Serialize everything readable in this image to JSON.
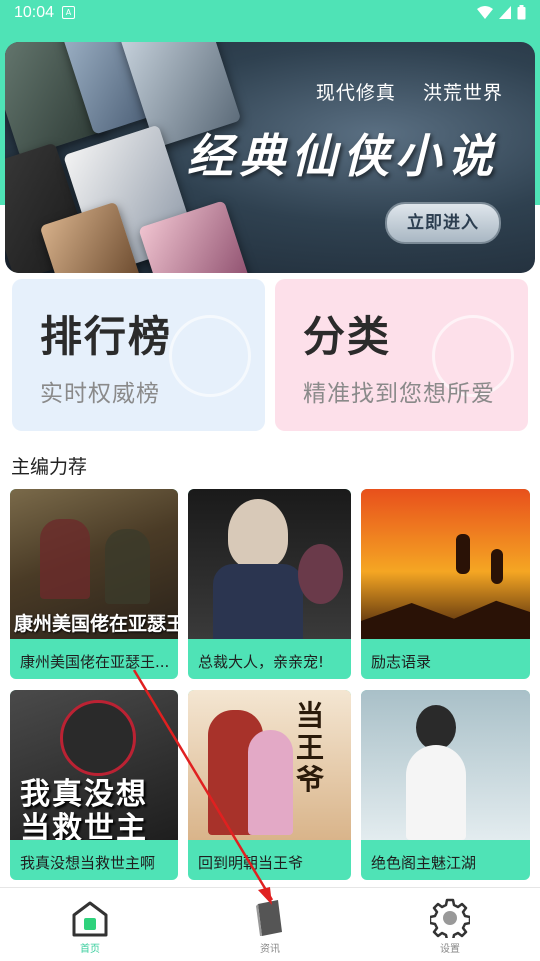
{
  "status_bar": {
    "time": "10:04"
  },
  "banner": {
    "tag_1": "现代修真",
    "tag_2": "洪荒世界",
    "title": "经典仙侠小说",
    "enter_button": "立即进入"
  },
  "entry_cards": [
    {
      "title": "排行榜",
      "subtitle": "实时权威榜"
    },
    {
      "title": "分类",
      "subtitle": "精准找到您想所爱"
    }
  ],
  "section_title": "主编力荐",
  "books": [
    {
      "title": "康州美国佬在亚瑟王...",
      "cover_text": "康州美国佬在亚瑟王朝"
    },
    {
      "title": "总裁大人，亲亲宠!"
    },
    {
      "title": "励志语录"
    },
    {
      "title": "我真没想当救世主啊",
      "cover_text": "我真没想当救世主啊"
    },
    {
      "title": "回到明朝当王爷",
      "cover_text": "当王爷"
    },
    {
      "title": "绝色阁主魅江湖"
    }
  ],
  "nav": [
    {
      "label": "首页",
      "icon": "home-icon",
      "active": true
    },
    {
      "label": "资讯",
      "icon": "book-icon",
      "active": false
    },
    {
      "label": "设置",
      "icon": "gear-icon",
      "active": false
    }
  ],
  "colors": {
    "accent": "#4fe3b6",
    "active_nav": "#3ccf9f",
    "annotation_arrow": "#e02020"
  }
}
